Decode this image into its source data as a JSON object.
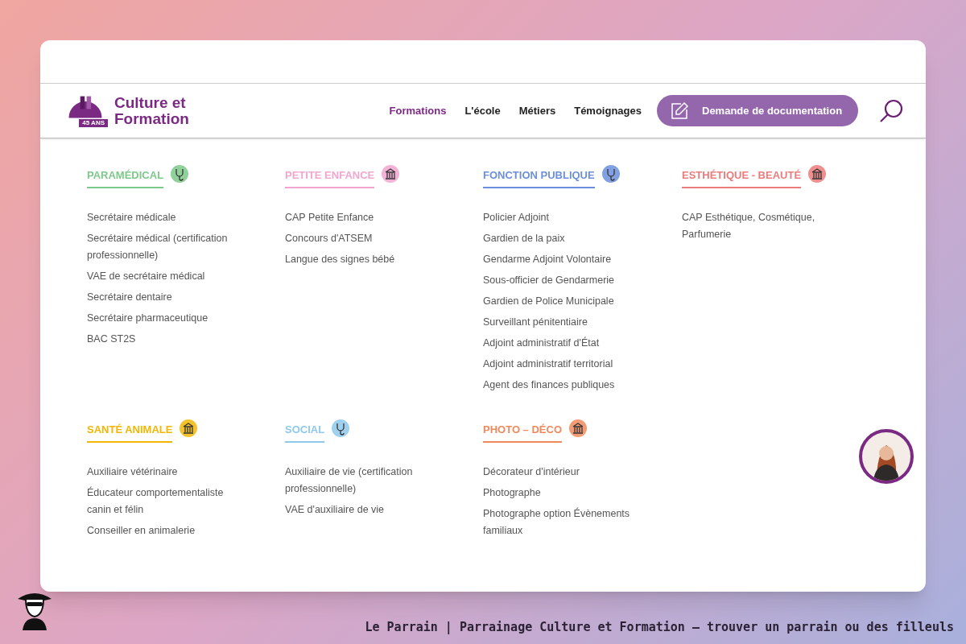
{
  "header": {
    "logo": {
      "badge": "45 ANS",
      "name_line_1": "Culture et",
      "name_line_2": "Formation"
    },
    "nav": [
      {
        "label": "Formations",
        "selected": true
      },
      {
        "label": "L'école",
        "selected": false
      },
      {
        "label": "Métiers",
        "selected": false
      },
      {
        "label": "Témoignages",
        "selected": false
      }
    ],
    "cta_button": "Demande de documentation"
  },
  "menu_rows": [
    [
      {
        "title": "PARAMÉDICAL",
        "color": "#7cc98a",
        "items": [
          "Secrétaire médicale",
          "Secrétaire médical (certification professionnelle)",
          "VAE de secrétaire médical",
          "Secrétaire dentaire",
          "Secrétaire pharmaceutique",
          "BAC ST2S"
        ]
      },
      {
        "title": "PETITE ENFANCE",
        "color": "#f2a6cf",
        "items": [
          "CAP Petite Enfance",
          "Concours d'ATSEM",
          "Langue des signes bébé"
        ]
      },
      {
        "title": "FONCTION PUBLIQUE",
        "color": "#6b8fdc",
        "items": [
          "Policier Adjoint",
          "Gardien de la paix",
          "Gendarme Adjoint Volontaire",
          "Sous-officier de Gendarmerie",
          "Gardien de Police Municipale",
          "Surveillant pénitentiaire",
          "Adjoint administratif d'État",
          "Adjoint administratif territorial",
          "Agent des finances publiques"
        ]
      },
      {
        "title": "ESTHÉTIQUE - BEAUTÉ",
        "color": "#ec7b7b",
        "items": [
          "CAP Esthétique, Cosmétique, Parfumerie"
        ]
      }
    ],
    [
      {
        "title": "SANTÉ ANIMALE",
        "color": "#f2b705",
        "items": [
          "Auxiliaire vétérinaire",
          "Éducateur comportementaliste canin et félin",
          "Conseiller en animalerie"
        ]
      },
      {
        "title": "SOCIAL",
        "color": "#8ec9ec",
        "items": [
          "Auxiliaire de vie (certification professionnelle)",
          "VAE d'auxiliaire de vie"
        ]
      },
      {
        "title": "PHOTO – DÉCO",
        "color": "#f08a5d",
        "items": [
          "Décorateur d'intérieur",
          "Photographe",
          "Photographe option Évènements familiaux"
        ]
      }
    ]
  ],
  "caption": "Le Parrain | Parrainage Culture et Formation — trouver un parrain ou des filleuls"
}
